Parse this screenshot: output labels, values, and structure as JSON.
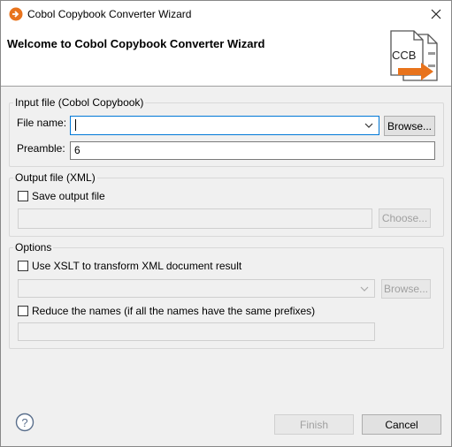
{
  "window": {
    "title": "Cobol Copybook Converter Wizard"
  },
  "header": {
    "title": "Welcome to Cobol Copybook Converter Wizard",
    "logo_text": "CCB"
  },
  "input_group": {
    "legend": "Input file (Cobol Copybook)",
    "file_name_label": "File name:",
    "file_name_value": "",
    "browse_label": "Browse...",
    "preamble_label": "Preamble:",
    "preamble_value": "6"
  },
  "output_group": {
    "legend": "Output file (XML)",
    "save_label": "Save output file",
    "save_checked": false,
    "path_value": "",
    "choose_label": "Choose..."
  },
  "options_group": {
    "legend": "Options",
    "xslt_label": "Use XSLT to transform XML document result",
    "xslt_checked": false,
    "xslt_value": "",
    "browse_label": "Browse...",
    "reduce_label": "Reduce the names (if all the names have the same prefixes)",
    "reduce_checked": false,
    "reduce_value": ""
  },
  "footer": {
    "finish_label": "Finish",
    "cancel_label": "Cancel"
  },
  "colors": {
    "accent": "#0078d7",
    "logo_arrow": "#e8731c",
    "disabled_text": "#a0a0a0"
  }
}
